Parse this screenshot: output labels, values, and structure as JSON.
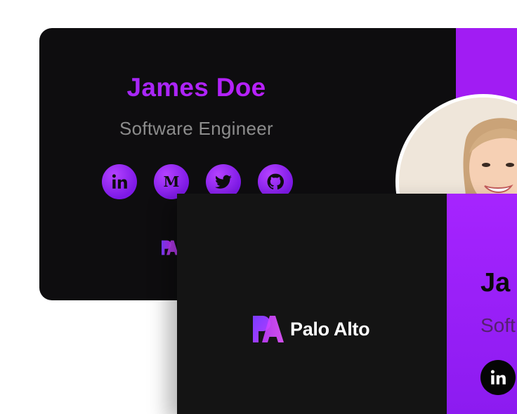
{
  "back_card": {
    "name": "James Doe",
    "role": "Software Engineer",
    "socials": [
      {
        "icon": "linkedin-icon"
      },
      {
        "icon": "medium-icon"
      },
      {
        "icon": "twitter-icon"
      },
      {
        "icon": "github-icon"
      }
    ],
    "accent_color": "#a11cf3"
  },
  "front_card": {
    "brand": "Palo Alto",
    "name": "Ja",
    "role": "Soft",
    "accent_color": "#a624ff"
  },
  "colors": {
    "name_gradient_start": "#9b2cf5",
    "name_gradient_end": "#c41bff",
    "card_background": "#0e0d0f",
    "social_purple": "#8f26f0"
  }
}
